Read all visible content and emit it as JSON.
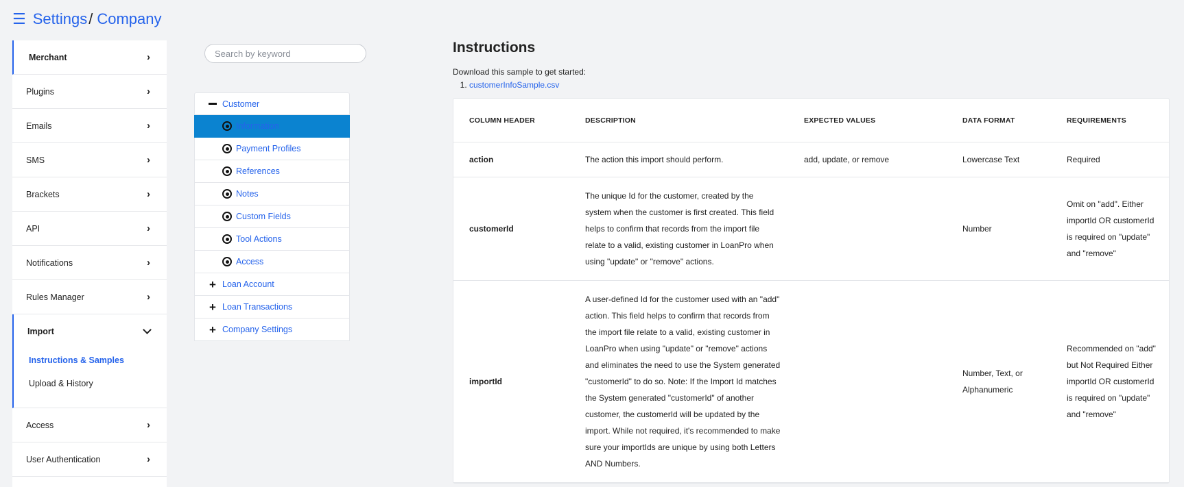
{
  "header": {
    "menu_icon": "hamburger-icon",
    "crumbs": [
      "Settings",
      "Company"
    ],
    "separator": "/"
  },
  "sidebar": {
    "items": [
      {
        "label": "Merchant"
      },
      {
        "label": "Plugins"
      },
      {
        "label": "Emails"
      },
      {
        "label": "SMS"
      },
      {
        "label": "Brackets"
      },
      {
        "label": "API"
      },
      {
        "label": "Notifications"
      },
      {
        "label": "Rules Manager"
      }
    ],
    "import": {
      "label": "Import",
      "subitems": [
        "Instructions & Samples",
        "Upload & History"
      ]
    },
    "items_after": [
      {
        "label": "Access"
      },
      {
        "label": "User Authentication"
      }
    ]
  },
  "search": {
    "placeholder": "Search by keyword",
    "value": ""
  },
  "tree": {
    "customer": {
      "label": "Customer",
      "children": [
        "Information",
        "Payment Profiles",
        "References",
        "Notes",
        "Custom Fields",
        "Tool Actions",
        "Access"
      ]
    },
    "others": [
      "Loan Account",
      "Loan Transactions",
      "Company Settings"
    ]
  },
  "main": {
    "title": "Instructions",
    "download_text": "Download this sample to get started:",
    "samples": [
      "customerInfoSample.csv"
    ],
    "table": {
      "headers": [
        "COLUMN HEADER",
        "DESCRIPTION",
        "EXPECTED VALUES",
        "DATA FORMAT",
        "REQUIREMENTS"
      ],
      "rows": [
        [
          "action",
          "The action this import should perform.",
          "add, update, or remove",
          "Lowercase Text",
          "Required"
        ],
        [
          "customerId",
          "The unique Id for the customer, created by the system when the customer is first created. This field helps to confirm that records from the import file relate to a valid, existing customer in LoanPro when using \"update\" or \"remove\" actions.",
          "",
          "Number",
          "Omit on \"add\". Either importId OR customerId is required on \"update\" and \"remove\""
        ],
        [
          "importId",
          "A user-defined Id for the customer used with an \"add\" action. This field helps to confirm that records from the import file relate to a valid, existing customer in LoanPro when using \"update\" or \"remove\" actions and eliminates the need to use the System generated \"customerId\" to do so. Note: If the Import Id matches the System generated \"customerId\" of another customer, the customerId will be updated by the import. While not required, it's recommended to make sure your importIds are unique by using both Letters AND Numbers.",
          "",
          "Number, Text, or Alphanumeric",
          "Recommended on \"add\" but Not Required Either importId OR customerId is required on \"update\" and \"remove\""
        ]
      ]
    }
  },
  "colors": {
    "accent": "#2563eb",
    "selected_bg": "#0b83d0",
    "page_bg": "#f2f3f5"
  }
}
